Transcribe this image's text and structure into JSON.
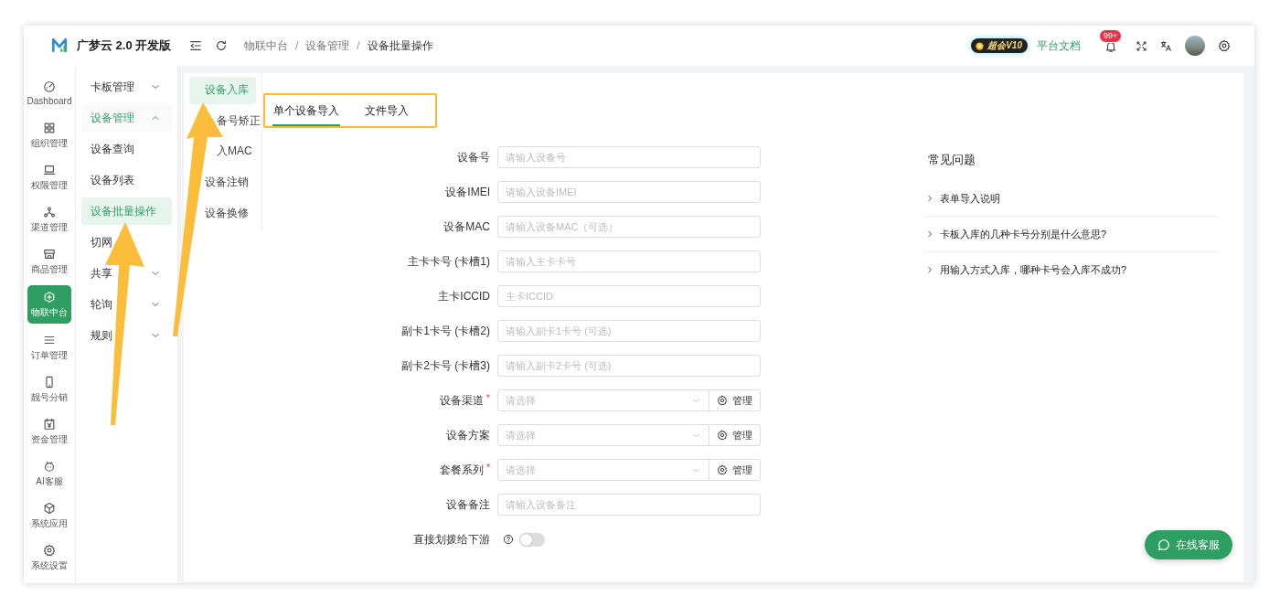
{
  "app": {
    "name": "广梦云 2.0 开发版"
  },
  "sidebar": {
    "items": [
      {
        "label": "Dashboard",
        "selected": false
      },
      {
        "label": "组织管理",
        "selected": false
      },
      {
        "label": "权限管理",
        "selected": false
      },
      {
        "label": "渠道管理",
        "selected": false
      },
      {
        "label": "商品管理",
        "selected": false
      },
      {
        "label": "物联中台",
        "selected": true
      },
      {
        "label": "订单管理",
        "selected": false
      },
      {
        "label": "靓号分销",
        "selected": false
      },
      {
        "label": "资金管理",
        "selected": false
      },
      {
        "label": "AI客服",
        "selected": false
      },
      {
        "label": "系统应用",
        "selected": false
      },
      {
        "label": "系统设置",
        "selected": false
      }
    ]
  },
  "submenu": {
    "items": [
      {
        "label": "卡板管理",
        "kind": "group",
        "expanded": false,
        "selected": false
      },
      {
        "label": "设备管理",
        "kind": "group",
        "expanded": true,
        "selected": true,
        "children": [
          {
            "label": "设备查询",
            "kind": "link",
            "selected": false
          },
          {
            "label": "设备列表",
            "kind": "link",
            "selected": false
          },
          {
            "label": "设备批量操作",
            "kind": "link",
            "selected": true
          }
        ]
      },
      {
        "label": "切网",
        "kind": "link",
        "selected": false
      },
      {
        "label": "共享",
        "kind": "group",
        "expanded": false,
        "selected": false
      },
      {
        "label": "轮询",
        "kind": "group",
        "expanded": false,
        "selected": false
      },
      {
        "label": "规则",
        "kind": "group",
        "expanded": false,
        "selected": false
      }
    ]
  },
  "header": {
    "breadcrumb": [
      {
        "kind": "crumb",
        "text": "物联中台"
      },
      {
        "kind": "separator",
        "text": "/"
      },
      {
        "kind": "crumb",
        "text": "设备管理"
      },
      {
        "kind": "separator",
        "text": "/"
      },
      {
        "kind": "current",
        "text": "设备批量操作"
      }
    ],
    "vip_badge": "超会V10",
    "docs_link": "平台文档",
    "notification_count": "99+"
  },
  "side_tabs": [
    {
      "label": "设备入库",
      "selected": true
    },
    {
      "label": "备号矫正",
      "selected": false,
      "cut_start": true
    },
    {
      "label": "入MAC",
      "selected": false,
      "cut_start": true
    },
    {
      "label": "设备注销",
      "selected": false
    },
    {
      "label": "设备换修",
      "selected": false
    }
  ],
  "tabs": {
    "highlighted": true,
    "items": [
      {
        "label": "单个设备导入",
        "selected": true
      },
      {
        "label": "文件导入",
        "selected": false
      }
    ]
  },
  "form": {
    "fields": [
      {
        "label": "设备号",
        "kind": "input",
        "placeholder": "请输入设备号"
      },
      {
        "label": "设备IMEI",
        "kind": "input",
        "placeholder": "请输入设备IMEI"
      },
      {
        "label": "设备MAC",
        "kind": "input",
        "placeholder": "请输入设备MAC（可选）"
      },
      {
        "label": "主卡卡号 (卡槽1)",
        "kind": "input",
        "placeholder": "请输入主卡卡号"
      },
      {
        "label": "主卡ICCID",
        "kind": "input",
        "placeholder": "主卡ICCID"
      },
      {
        "label": "副卡1卡号 (卡槽2)",
        "kind": "input",
        "placeholder": "请输入副卡1卡号 (可选)"
      },
      {
        "label": "副卡2卡号 (卡槽3)",
        "kind": "input",
        "placeholder": "请输入副卡2卡号 (可选)"
      },
      {
        "label": "设备渠道",
        "kind": "select",
        "required_mark": "*",
        "placeholder": "请选择",
        "action": "管理"
      },
      {
        "label": "设备方案",
        "kind": "select",
        "placeholder": "请选择",
        "action": "管理"
      },
      {
        "label": "套餐系列",
        "kind": "select",
        "required_mark": "*",
        "placeholder": "请选择",
        "action": "管理"
      },
      {
        "label": "设备备注",
        "kind": "input",
        "placeholder": "请输入设备备注"
      },
      {
        "label": "直接划拨给下游",
        "kind": "switch",
        "on": false
      }
    ]
  },
  "faq": {
    "title": "常见问题",
    "items": [
      {
        "label": "表单导入说明",
        "expanded": false
      },
      {
        "label": "卡板入库的几种卡号分别是什么意思?",
        "expanded": false
      },
      {
        "label": "用输入方式入库，哪种卡号会入库不成功?",
        "expanded": false
      }
    ]
  },
  "chat_button": "在线客服",
  "annotations": [
    {
      "kind": "arrow"
    },
    {
      "kind": "arrow"
    }
  ]
}
